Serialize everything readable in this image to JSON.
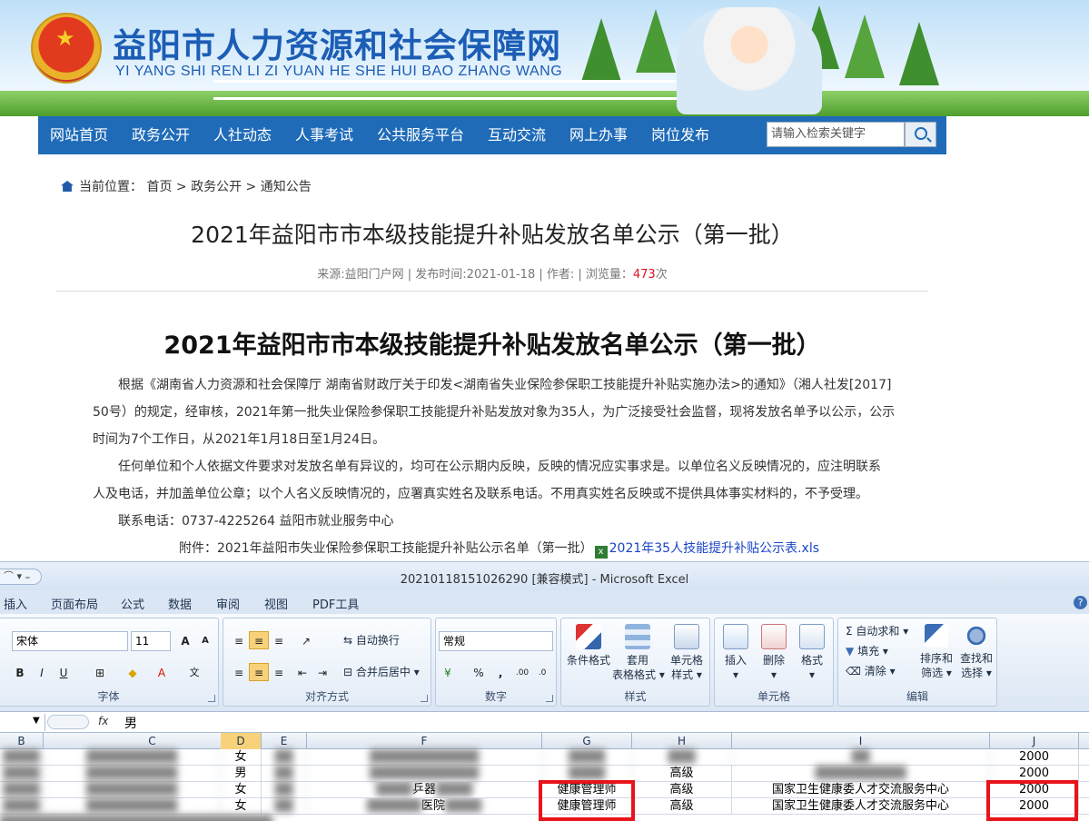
{
  "site": {
    "title": "益阳市人力资源和社会保障网",
    "subtitle": "YI YANG SHI REN LI ZI YUAN HE SHE HUI BAO ZHANG WANG"
  },
  "nav": {
    "items": [
      "网站首页",
      "政务公开",
      "人社动态",
      "人事考试",
      "公共服务平台",
      "互动交流",
      "网上办事",
      "岗位发布"
    ],
    "search_placeholder": "请输入检索关键字"
  },
  "breadcrumb": {
    "label": "当前位置：",
    "items": [
      "首页",
      "政务公开",
      "通知公告"
    ],
    "sep": ">"
  },
  "article": {
    "page_title": "2021年益阳市市本级技能提升补贴发放名单公示（第一批）",
    "meta_prefix": "来源:益阳门户网 | 发布时间:2021-01-18 | 作者: | 浏览量：",
    "views": "473",
    "meta_suffix": "次",
    "title": "2021年益阳市市本级技能提升补贴发放名单公示（第一批）",
    "paragraphs": [
      "根据《湖南省人力资源和社会保障厅 湖南省财政厅关于印发<湖南省失业保险参保职工技能提升补贴实施办法>的通知》（湘人社发[2017]",
      "50号）的规定，经审核，2021年第一批失业保险参保职工技能提升补贴发放对象为35人，为广泛接受社会监督，现将发放名单予以公示，公示",
      "时间为7个工作日，从2021年1月18日至1月24日。",
      "任何单位和个人依据文件要求对发放名单有异议的，均可在公示期内反映，反映的情况应实事求是。以单位名义反映情况的，应注明联系",
      "人及电话，并加盖单位公章；以个人名义反映情况的，应署真实姓名及联系电话。不用真实姓名反映或不提供具体事实材料的，不予受理。",
      "联系电话：0737-4225264 益阳市就业服务中心"
    ],
    "attachment_label": "附件：2021年益阳市失业保险参保职工技能提升补贴公示名单（第一批）",
    "attachment_link": "2021年35人技能提升补贴公示表.xls"
  },
  "excel": {
    "title": "20210118151026290  [兼容模式] - Microsoft Excel",
    "tabs": [
      "插入",
      "页面布局",
      "公式",
      "数据",
      "审阅",
      "视图",
      "PDF工具"
    ],
    "font_name": "宋体",
    "font_size": "11",
    "number_format": "常规",
    "buttons": {
      "wrap": "自动换行",
      "merge": "合并后居中 ▾",
      "cond_format": "条件格式",
      "table_format": "套用\n表格格式 ▾",
      "cell_style": "单元格\n样式 ▾",
      "insert": "插入",
      "delete": "删除",
      "format": "格式",
      "autosum": "自动求和 ▾",
      "fill": "填充 ▾",
      "clear": "清除 ▾",
      "sort": "排序和\n筛选 ▾",
      "find": "查找和\n选择 ▾"
    },
    "groups": [
      "字体",
      "对齐方式",
      "数字",
      "样式",
      "单元格",
      "编辑"
    ],
    "formula_value": "男",
    "fx": "fx",
    "columns": [
      "B",
      "C",
      "D",
      "E",
      "F",
      "G",
      "H",
      "I",
      "J"
    ],
    "rows": [
      {
        "gender": "女",
        "job": "",
        "level": "",
        "org": "",
        "amount": "2000"
      },
      {
        "gender": "男",
        "job": "",
        "level": "高级",
        "org": "",
        "amount": "2000"
      },
      {
        "gender": "女",
        "job": "健康管理师",
        "level": "高级",
        "org": "国家卫生健康委人才交流服务中心",
        "amount": "2000",
        "f_part": "乒器"
      },
      {
        "gender": "女",
        "job": "健康管理师",
        "level": "高级",
        "org": "国家卫生健康委人才交流服务中心",
        "amount": "2000",
        "f_part": "医院"
      }
    ]
  }
}
